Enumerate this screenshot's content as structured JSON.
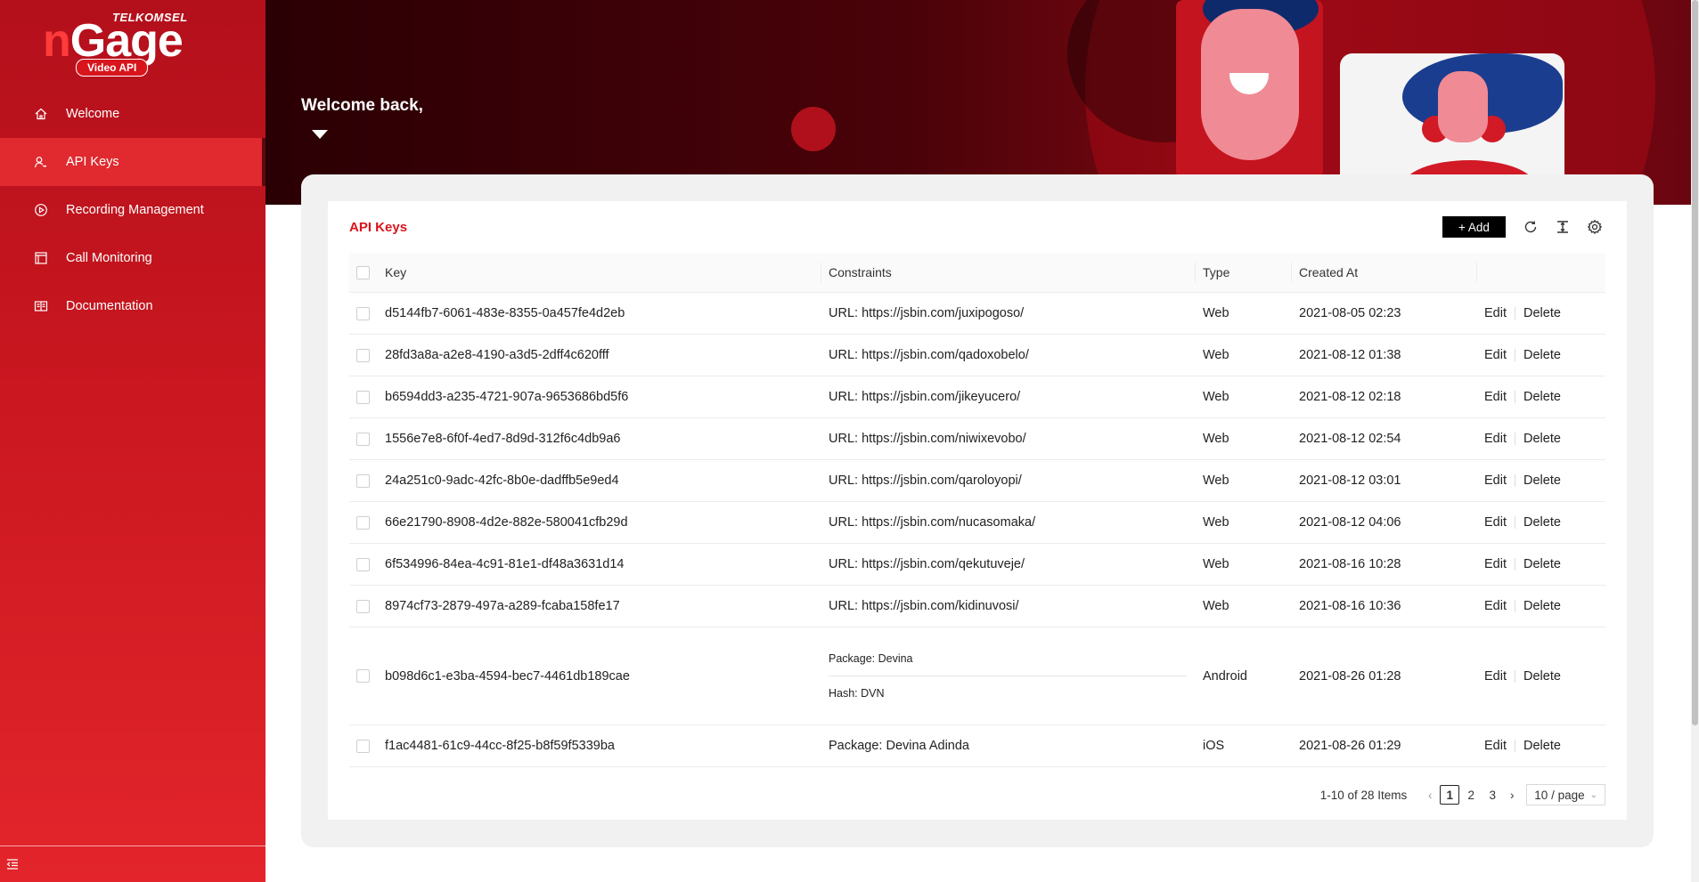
{
  "brand": {
    "top": "TELKOMSEL",
    "main_n": "n",
    "main_rest": "Gage",
    "sub": "Video API"
  },
  "sidebar": {
    "items": [
      {
        "label": "Welcome",
        "icon": "home-icon",
        "active": false
      },
      {
        "label": "API Keys",
        "icon": "key-user-icon",
        "active": true
      },
      {
        "label": "Recording Management",
        "icon": "play-circle-icon",
        "active": false
      },
      {
        "label": "Call Monitoring",
        "icon": "monitor-icon",
        "active": false
      },
      {
        "label": "Documentation",
        "icon": "book-icon",
        "active": false
      }
    ]
  },
  "hero": {
    "welcome": "Welcome back,"
  },
  "card": {
    "title": "API Keys",
    "add_label": "+ Add"
  },
  "table": {
    "headers": {
      "key": "Key",
      "constraints": "Constraints",
      "type": "Type",
      "created": "Created At"
    },
    "actions": {
      "edit": "Edit",
      "delete": "Delete"
    },
    "rows": [
      {
        "key": "d5144fb7-6061-483e-8355-0a457fe4d2eb",
        "constraints": [
          "URL: https://jsbin.com/juxipogoso/"
        ],
        "type": "Web",
        "created": "2021-08-05 02:23"
      },
      {
        "key": "28fd3a8a-a2e8-4190-a3d5-2dff4c620fff",
        "constraints": [
          "URL: https://jsbin.com/qadoxobelo/"
        ],
        "type": "Web",
        "created": "2021-08-12 01:38"
      },
      {
        "key": "b6594dd3-a235-4721-907a-9653686bd5f6",
        "constraints": [
          "URL: https://jsbin.com/jikeyucero/"
        ],
        "type": "Web",
        "created": "2021-08-12 02:18"
      },
      {
        "key": "1556e7e8-6f0f-4ed7-8d9d-312f6c4db9a6",
        "constraints": [
          "URL: https://jsbin.com/niwixevobo/"
        ],
        "type": "Web",
        "created": "2021-08-12 02:54"
      },
      {
        "key": "24a251c0-9adc-42fc-8b0e-dadffb5e9ed4",
        "constraints": [
          "URL: https://jsbin.com/qaroloyopi/"
        ],
        "type": "Web",
        "created": "2021-08-12 03:01"
      },
      {
        "key": "66e21790-8908-4d2e-882e-580041cfb29d",
        "constraints": [
          "URL: https://jsbin.com/nucasomaka/"
        ],
        "type": "Web",
        "created": "2021-08-12 04:06"
      },
      {
        "key": "6f534996-84ea-4c91-81e1-df48a3631d14",
        "constraints": [
          "URL: https://jsbin.com/qekutuveje/"
        ],
        "type": "Web",
        "created": "2021-08-16 10:28"
      },
      {
        "key": "8974cf73-2879-497a-a289-fcaba158fe17",
        "constraints": [
          "URL: https://jsbin.com/kidinuvosi/"
        ],
        "type": "Web",
        "created": "2021-08-16 10:36"
      },
      {
        "key": "b098d6c1-e3ba-4594-bec7-4461db189cae",
        "constraints": [
          "Package: Devina",
          "Hash: DVN"
        ],
        "type": "Android",
        "created": "2021-08-26 01:28"
      },
      {
        "key": "f1ac4481-61c9-44cc-8f25-b8f59f5339ba",
        "constraints": [
          "Package: Devina Adinda"
        ],
        "type": "iOS",
        "created": "2021-08-26 01:29"
      }
    ]
  },
  "pagination": {
    "total": "1-10 of 28 Items",
    "pages": [
      "1",
      "2",
      "3"
    ],
    "current": "1",
    "page_size": "10 / page"
  },
  "colors": {
    "brand_red": "#d8141c",
    "sidebar_active": "#e02a2f",
    "add_button": "#000000"
  }
}
